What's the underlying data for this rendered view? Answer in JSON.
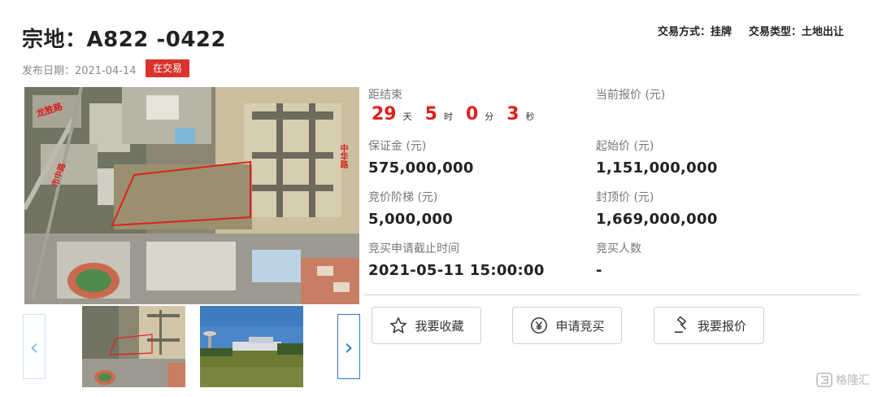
{
  "header": {
    "title": "宗地：A822 -0422",
    "trade_method": "交易方式：挂牌",
    "trade_type": "交易类型：土地出让",
    "publish_date": "发布日期：2021-04-14",
    "status_badge": "在交易"
  },
  "countdown": {
    "label": "距结束",
    "days": "29",
    "days_unit": "天",
    "hours": "5",
    "hours_unit": "时",
    "minutes": "0",
    "minutes_unit": "分",
    "seconds": "3",
    "seconds_unit": "秒"
  },
  "info": {
    "current_price_label": "当前报价 (元)",
    "current_price_value": "",
    "deposit_label": "保证金 (元)",
    "deposit_value": "575,000,000",
    "start_price_label": "起始价 (元)",
    "start_price_value": "1,151,000,000",
    "increment_label": "竞价阶梯 (元)",
    "increment_value": "5,000,000",
    "cap_price_label": "封顶价 (元)",
    "cap_price_value": "1,669,000,000",
    "deadline_label": "竞买申请截止时间",
    "deadline_value": "2021-05-11 15:00:00",
    "bidders_label": "竞买人数",
    "bidders_value": "-"
  },
  "map_labels": {
    "road_1": "龙胜路",
    "road_2": "中华路",
    "road_3": "市中路"
  },
  "actions": {
    "favorite": "我要收藏",
    "apply": "申请竞买",
    "bid": "我要报价"
  },
  "icons": {
    "prev": "chevron-left-icon",
    "next": "chevron-right-icon",
    "favorite": "star-icon",
    "apply": "yen-coin-icon",
    "bid": "gavel-icon"
  },
  "colors": {
    "accent_red": "#e0201e",
    "badge_red": "#d9342b",
    "arrow_blue": "#2a7ac9"
  },
  "watermark": "格隆汇"
}
